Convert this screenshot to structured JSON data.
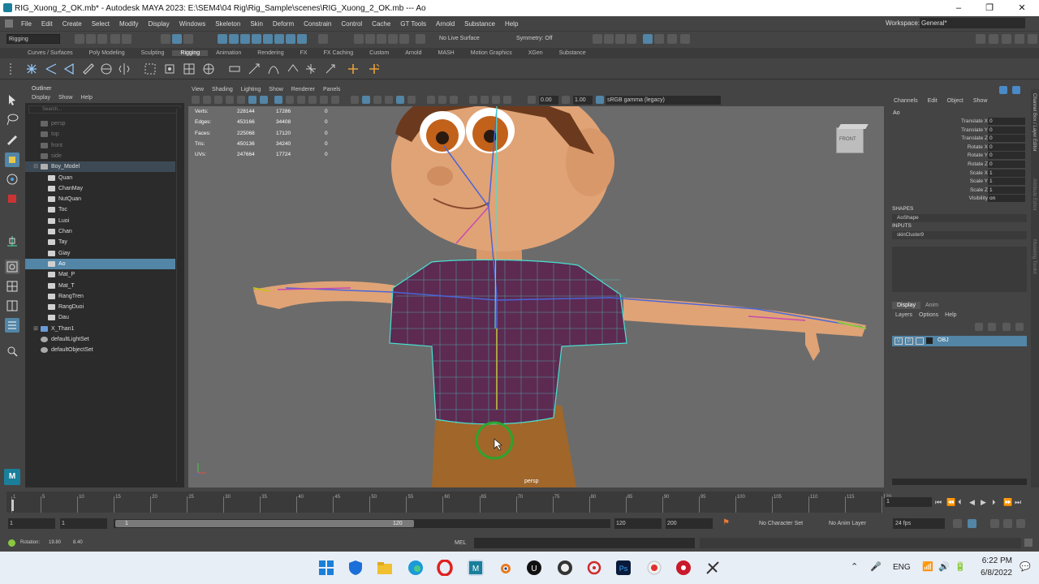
{
  "window": {
    "title": "RIG_Xuong_2_OK.mb* - Autodesk MAYA 2023: E:\\SEM4\\04 Rig\\Rig_Sample\\scenes\\RIG_Xuong_2_OK.mb   ---   Ao",
    "minimize": "–",
    "maximize": "❐",
    "close": "✕"
  },
  "menubar": {
    "items": [
      "File",
      "Edit",
      "Create",
      "Select",
      "Modify",
      "Display",
      "Windows",
      "Skeleton",
      "Skin",
      "Deform",
      "Constrain",
      "Control",
      "Cache",
      "GT Tools",
      "Arnold",
      "Substance",
      "Help"
    ],
    "workspace_label": "Workspace:",
    "workspace_value": "General*"
  },
  "statusline": {
    "menuset": "Rigging",
    "live_surface": "No Live Surface",
    "symmetry": "Symmetry: Off"
  },
  "shelf": {
    "tabs": [
      "Curves / Surfaces",
      "Poly Modeling",
      "Sculpting",
      "Rigging",
      "Animation",
      "Rendering",
      "FX",
      "FX Caching",
      "Custom",
      "Arnold",
      "MASH",
      "Motion Graphics",
      "XGen",
      "Substance"
    ],
    "active_tab": "Rigging"
  },
  "outliner": {
    "title": "Outliner",
    "menu": [
      "Display",
      "Show",
      "Help"
    ],
    "search_placeholder": "Search...",
    "items": [
      {
        "label": "persp",
        "indent": 1,
        "grey": true,
        "icon": "camera-icon"
      },
      {
        "label": "top",
        "indent": 1,
        "grey": true,
        "icon": "camera-icon"
      },
      {
        "label": "front",
        "indent": 1,
        "grey": true,
        "icon": "camera-icon"
      },
      {
        "label": "side",
        "indent": 1,
        "grey": true,
        "icon": "camera-icon"
      },
      {
        "label": "Boy_Model",
        "indent": 1,
        "grey": false,
        "icon": "group-icon",
        "expand": "⊟",
        "hl": true
      },
      {
        "label": "Quan",
        "indent": 2,
        "grey": false,
        "icon": "mesh-icon"
      },
      {
        "label": "ChanMay",
        "indent": 2,
        "grey": false,
        "icon": "mesh-icon"
      },
      {
        "label": "NutQuan",
        "indent": 2,
        "grey": false,
        "icon": "mesh-icon"
      },
      {
        "label": "Toc",
        "indent": 2,
        "grey": false,
        "icon": "mesh-icon"
      },
      {
        "label": "Luoi",
        "indent": 2,
        "grey": false,
        "icon": "mesh-icon"
      },
      {
        "label": "Chan",
        "indent": 2,
        "grey": false,
        "icon": "mesh-icon"
      },
      {
        "label": "Tay",
        "indent": 2,
        "grey": false,
        "icon": "mesh-icon"
      },
      {
        "label": "Giay",
        "indent": 2,
        "grey": false,
        "icon": "mesh-icon"
      },
      {
        "label": "Ao",
        "indent": 2,
        "grey": false,
        "icon": "mesh-icon",
        "selected": true
      },
      {
        "label": "Mat_P",
        "indent": 2,
        "grey": false,
        "icon": "mesh-icon"
      },
      {
        "label": "Mat_T",
        "indent": 2,
        "grey": false,
        "icon": "mesh-icon"
      },
      {
        "label": "RangTren",
        "indent": 2,
        "grey": false,
        "icon": "mesh-icon"
      },
      {
        "label": "RangDuoi",
        "indent": 2,
        "grey": false,
        "icon": "mesh-icon"
      },
      {
        "label": "Dau",
        "indent": 2,
        "grey": false,
        "icon": "mesh-icon"
      },
      {
        "label": "X_Than1",
        "indent": 1,
        "grey": false,
        "icon": "joint-icon",
        "expand": "⊞"
      },
      {
        "label": "defaultLightSet",
        "indent": 1,
        "grey": false,
        "icon": "set-icon"
      },
      {
        "label": "defaultObjectSet",
        "indent": 1,
        "grey": false,
        "icon": "set-icon"
      }
    ]
  },
  "viewport": {
    "menu": [
      "View",
      "Shading",
      "Lighting",
      "Show",
      "Renderer",
      "Panels"
    ],
    "field1": "0.00",
    "field2": "1.00",
    "colorspace": "sRGB gamma (legacy)",
    "camera_label": "persp",
    "viewcube": "FRONT",
    "hud": [
      {
        "k": "Verts:",
        "a": "228144",
        "b": "17286",
        "c": "0"
      },
      {
        "k": "Edges:",
        "a": "453166",
        "b": "34408",
        "c": "0"
      },
      {
        "k": "Faces:",
        "a": "225068",
        "b": "17120",
        "c": "0"
      },
      {
        "k": "Tris:",
        "a": "450136",
        "b": "34240",
        "c": "0"
      },
      {
        "k": "UVs:",
        "a": "247664",
        "b": "17724",
        "c": "0"
      }
    ]
  },
  "channelbox": {
    "menu": [
      "Channels",
      "Edit",
      "Object",
      "Show"
    ],
    "object": "Ao",
    "attrs": [
      {
        "n": "Translate X",
        "v": "0"
      },
      {
        "n": "Translate Y",
        "v": "0"
      },
      {
        "n": "Translate Z",
        "v": "0"
      },
      {
        "n": "Rotate X",
        "v": "0"
      },
      {
        "n": "Rotate Y",
        "v": "0"
      },
      {
        "n": "Rotate Z",
        "v": "0"
      },
      {
        "n": "Scale X",
        "v": "1"
      },
      {
        "n": "Scale Y",
        "v": "1"
      },
      {
        "n": "Scale Z",
        "v": "1"
      },
      {
        "n": "Visibility",
        "v": "on"
      }
    ],
    "shapes_label": "SHAPES",
    "shape": "AoShape",
    "inputs_label": "INPUTS",
    "input": "skinCluster9",
    "layer_tabs": [
      "Display",
      "Anim"
    ],
    "layer_menu": [
      "Layers",
      "Options",
      "Help"
    ],
    "layer_v": "V",
    "layer_p": "P",
    "layer_name": "OBJ",
    "side_tabs": [
      "Channel Box / Layer Editor",
      "Attribute Editor",
      "Modeling Toolkit"
    ]
  },
  "timeline": {
    "ticks": [
      "1",
      "5",
      "10",
      "15",
      "20",
      "25",
      "30",
      "35",
      "40",
      "45",
      "50",
      "55",
      "60",
      "65",
      "70",
      "75",
      "80",
      "85",
      "90",
      "95",
      "100",
      "105",
      "110",
      "115",
      "120"
    ],
    "current_frame": "1",
    "range_start": "1",
    "range_inner_start": "1",
    "range_slider_start": "1",
    "range_slider_end": "120",
    "range_inner_end": "120",
    "range_end": "200",
    "char_set": "No Character Set",
    "anim_layer": "No Anim Layer",
    "fps": "24 fps"
  },
  "helpline": {
    "text": "Rotation:",
    "v1": "19.80",
    "v2": "8.40",
    "mel": "MEL"
  },
  "taskbar": {
    "lang": "ENG",
    "time": "6:22 PM",
    "date": "6/8/2022"
  },
  "colors": {
    "selection": "#5285a6",
    "panel": "#444444",
    "dark": "#2b2b2b",
    "viewport": "#6b6b6b"
  }
}
